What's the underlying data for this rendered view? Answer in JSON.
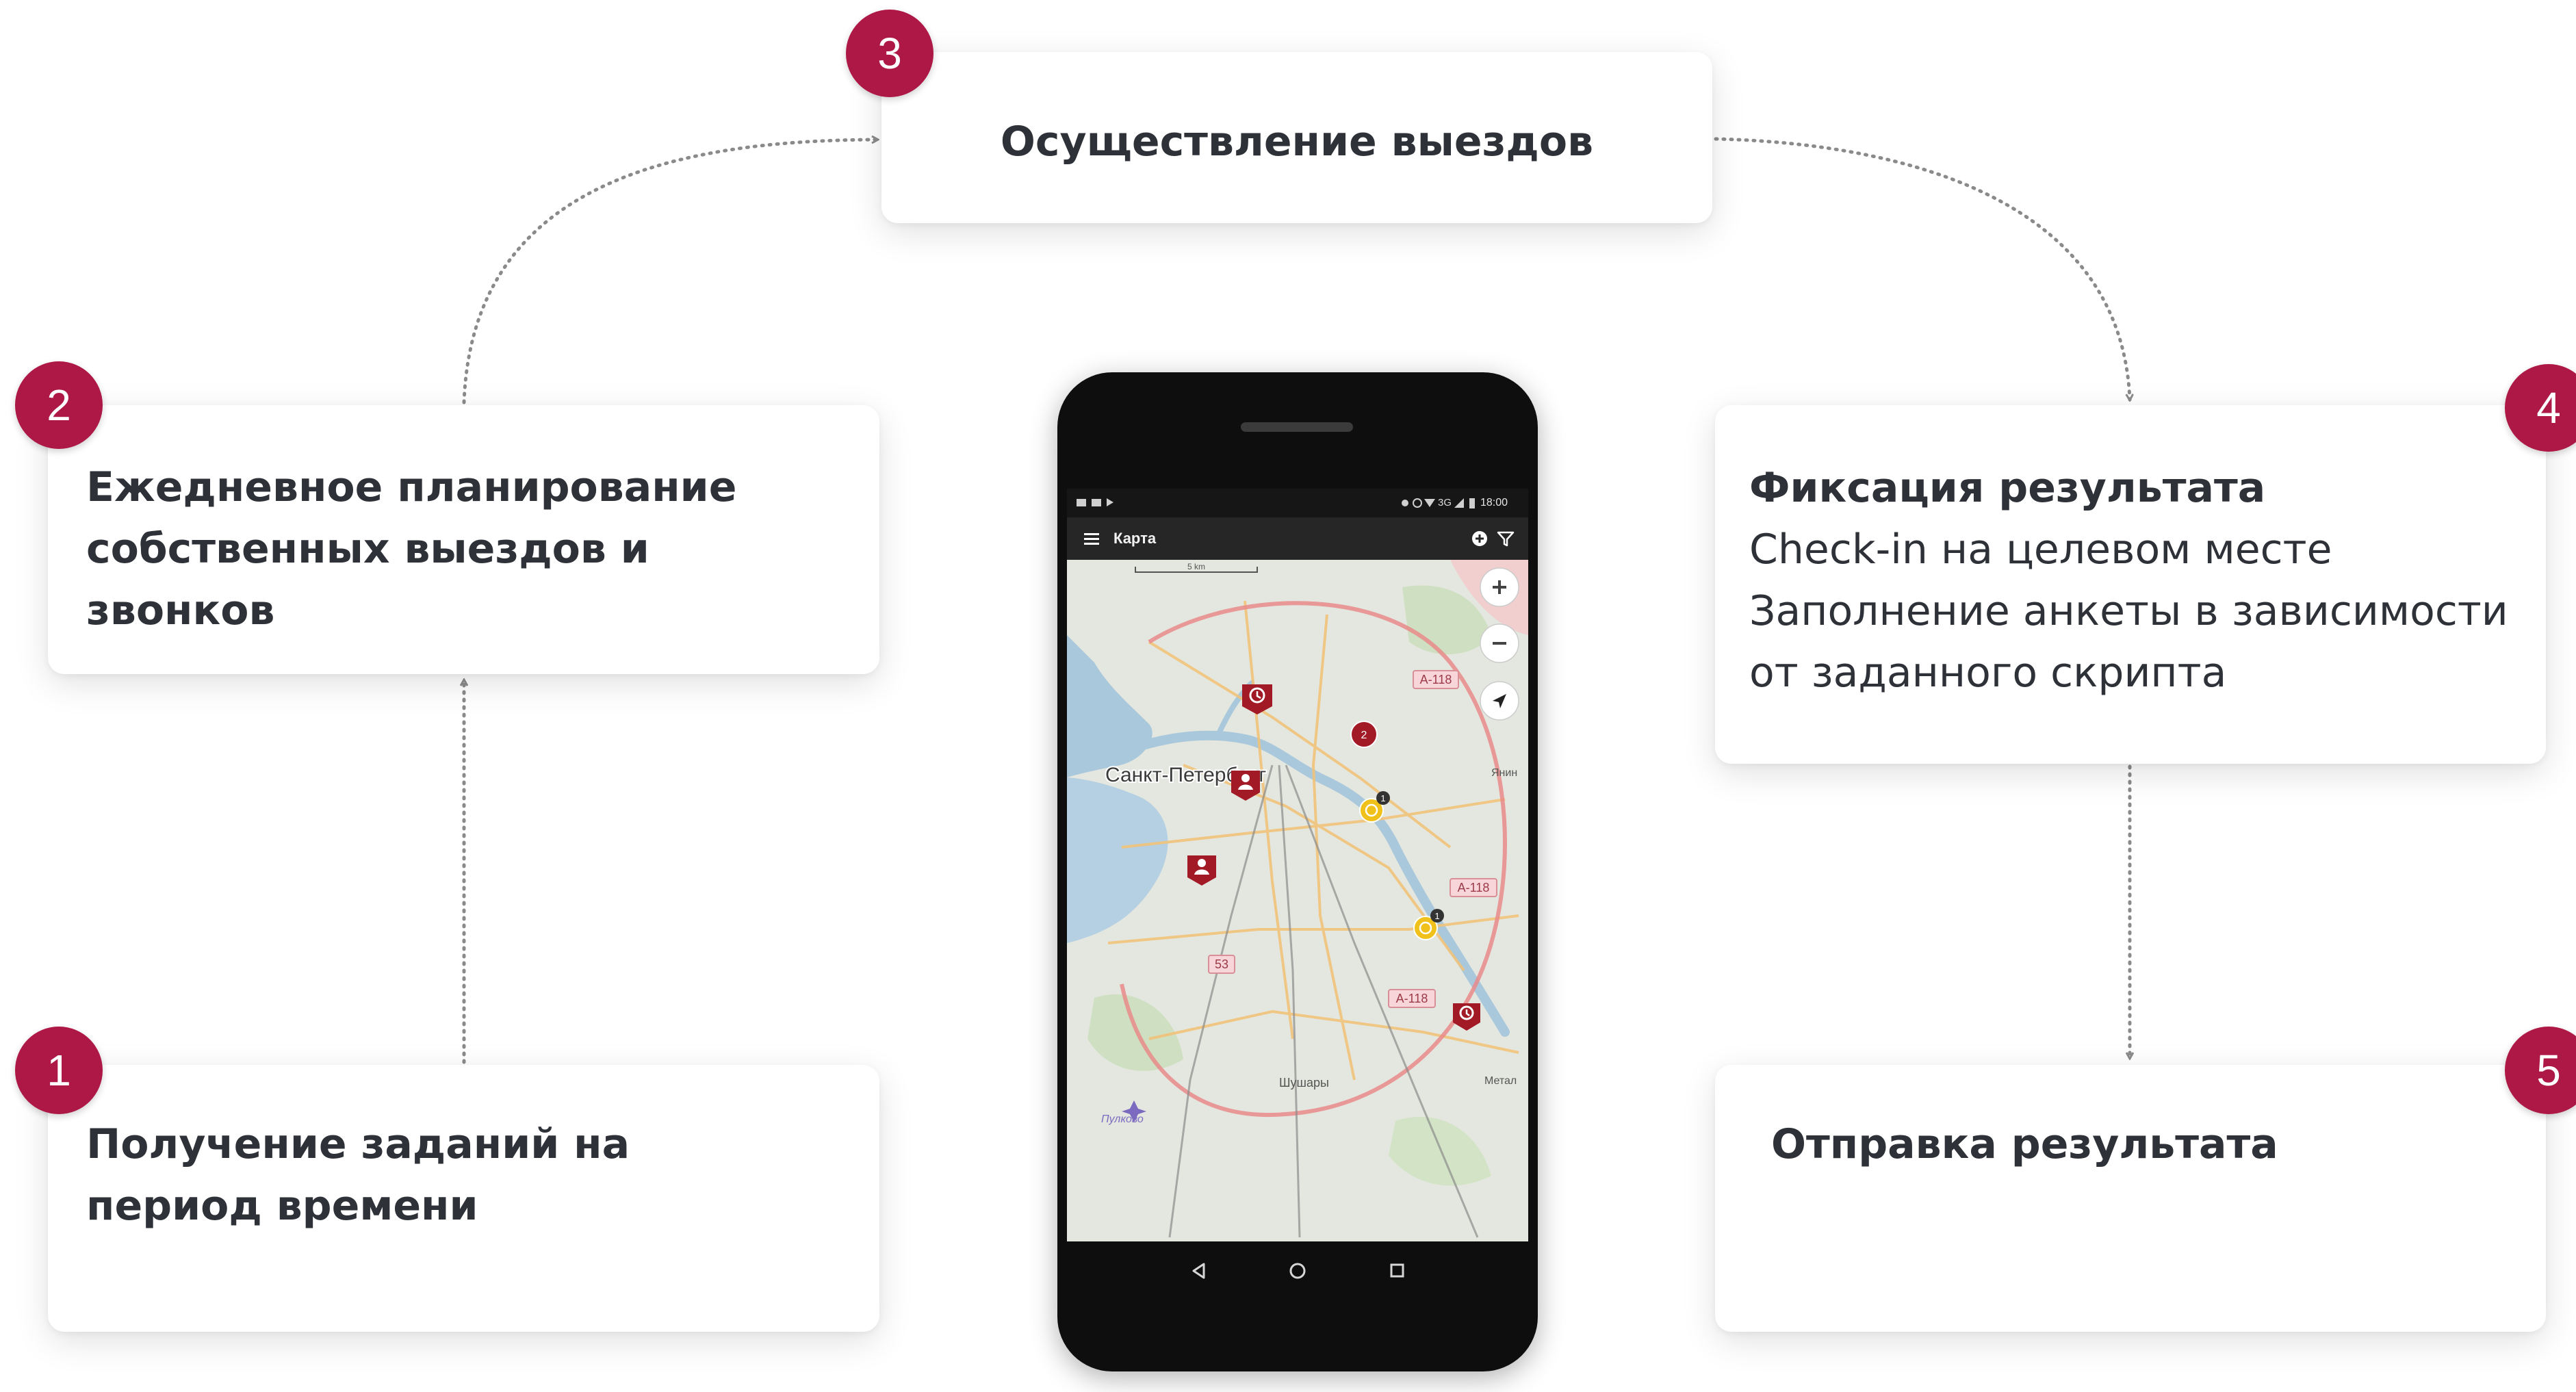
{
  "steps": [
    {
      "number": "1",
      "title_lines": [
        "Получение заданий на",
        "период времени"
      ]
    },
    {
      "number": "2",
      "title_lines": [
        "Ежедневное планирование",
        "собственных выездов и",
        "звонков"
      ]
    },
    {
      "number": "3",
      "title": "Осуществление выездов"
    },
    {
      "number": "4",
      "title": "Фиксация результата",
      "details": [
        "Check-in на целевом месте",
        "Заполнение анкеты в зависимости",
        "от заданного скрипта"
      ]
    },
    {
      "number": "5",
      "title": "Отправка результата"
    }
  ],
  "phone": {
    "status_time": "18:00",
    "status_network": "3G",
    "appbar_title": "Карта",
    "map": {
      "city_label": "Санкт-Петербург",
      "road_labels": [
        "А-118",
        "А-118",
        "А-118",
        "53"
      ],
      "place_labels": [
        "Шушары",
        "Пулково",
        "Янин",
        "Метал"
      ],
      "cluster_counts": [
        "2",
        "1",
        "1"
      ],
      "scale_label": "5 km"
    }
  },
  "colors": {
    "accent": "#ad1846",
    "text": "#2e3238",
    "connector": "#8a8a8a"
  },
  "icons": [
    "menu-icon",
    "add-circle-icon",
    "filter-icon",
    "zoom-in-icon",
    "zoom-out-icon",
    "location-arrow-icon",
    "clock-marker-icon",
    "person-marker-icon",
    "back-nav-icon",
    "home-nav-icon",
    "recents-nav-icon"
  ]
}
